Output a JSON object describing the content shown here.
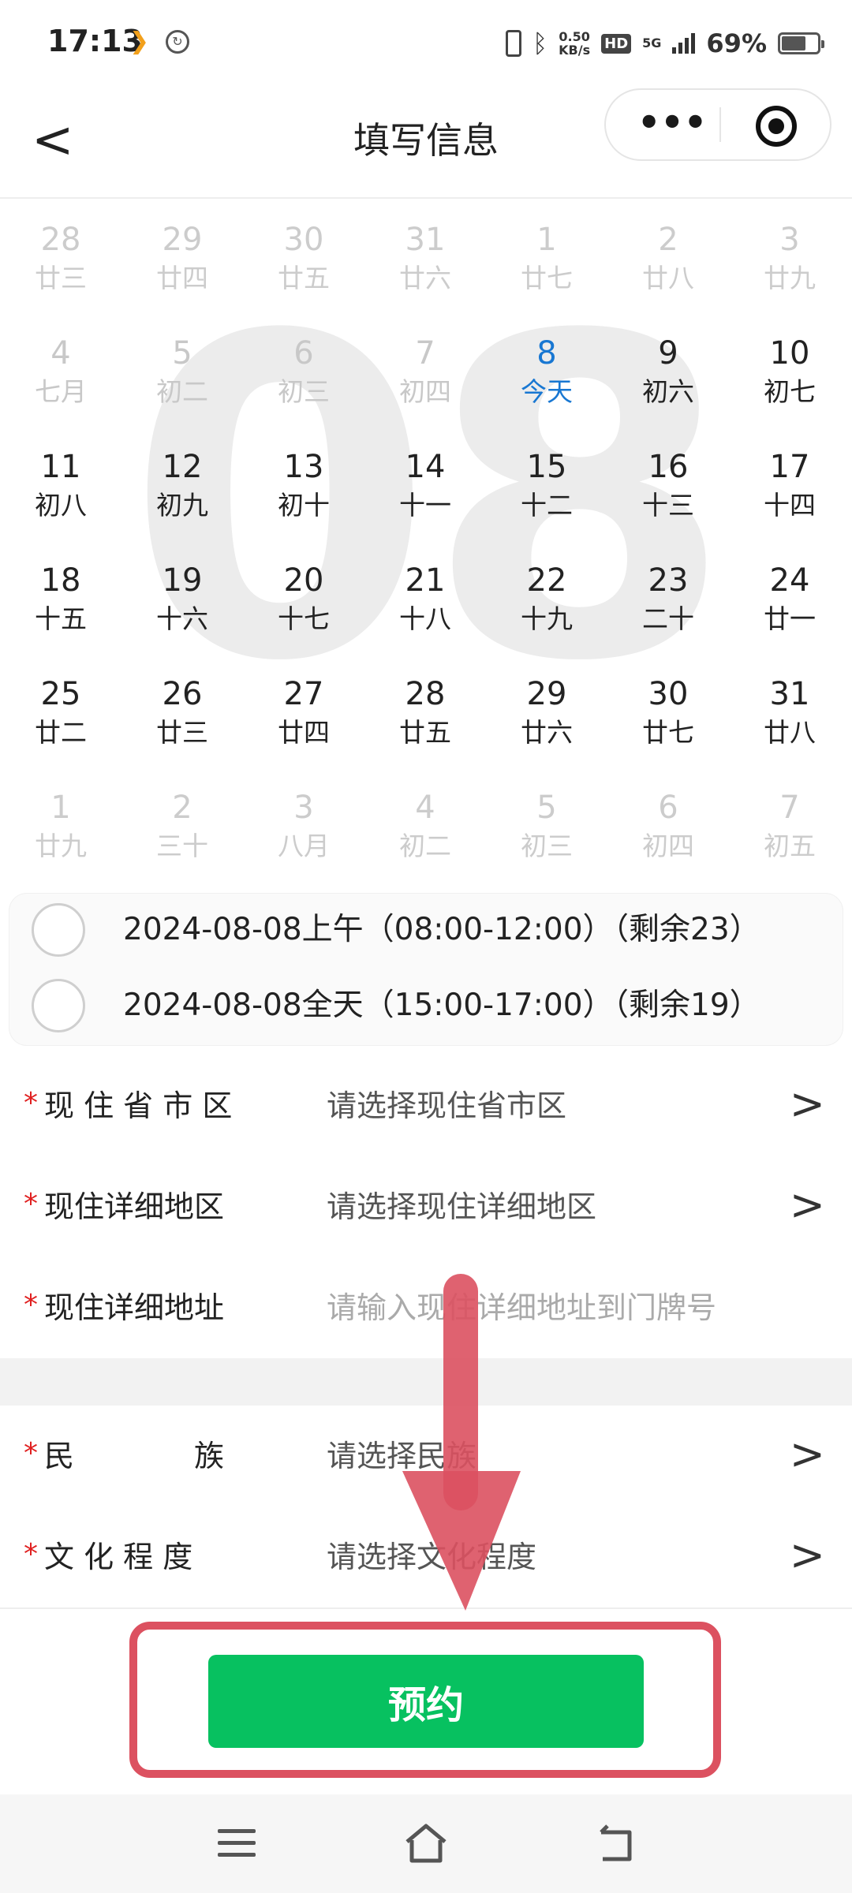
{
  "status_bar": {
    "time": "17:13",
    "speed_top": "0.50",
    "speed_bottom": "KB/s",
    "hd": "HD",
    "network": "5G",
    "battery": "69%"
  },
  "header": {
    "back_glyph": "<",
    "title": "填写信息",
    "more_glyph": "•••"
  },
  "calendar": {
    "month_watermark": "08",
    "rows": [
      [
        {
          "d": "28",
          "l": "廿三",
          "s": "other"
        },
        {
          "d": "29",
          "l": "廿四",
          "s": "other"
        },
        {
          "d": "30",
          "l": "廿五",
          "s": "other"
        },
        {
          "d": "31",
          "l": "廿六",
          "s": "other"
        },
        {
          "d": "1",
          "l": "廿七",
          "s": "other"
        },
        {
          "d": "2",
          "l": "廿八",
          "s": "other"
        },
        {
          "d": "3",
          "l": "廿九",
          "s": "other"
        }
      ],
      [
        {
          "d": "4",
          "l": "七月",
          "s": "past"
        },
        {
          "d": "5",
          "l": "初二",
          "s": "past"
        },
        {
          "d": "6",
          "l": "初三",
          "s": "past"
        },
        {
          "d": "7",
          "l": "初四",
          "s": "past"
        },
        {
          "d": "8",
          "l": "今天",
          "s": "today"
        },
        {
          "d": "9",
          "l": "初六",
          "s": "cur"
        },
        {
          "d": "10",
          "l": "初七",
          "s": "cur"
        }
      ],
      [
        {
          "d": "11",
          "l": "初八",
          "s": "cur"
        },
        {
          "d": "12",
          "l": "初九",
          "s": "cur"
        },
        {
          "d": "13",
          "l": "初十",
          "s": "cur"
        },
        {
          "d": "14",
          "l": "十一",
          "s": "cur"
        },
        {
          "d": "15",
          "l": "十二",
          "s": "cur"
        },
        {
          "d": "16",
          "l": "十三",
          "s": "cur"
        },
        {
          "d": "17",
          "l": "十四",
          "s": "cur"
        }
      ],
      [
        {
          "d": "18",
          "l": "十五",
          "s": "cur"
        },
        {
          "d": "19",
          "l": "十六",
          "s": "cur"
        },
        {
          "d": "20",
          "l": "十七",
          "s": "cur"
        },
        {
          "d": "21",
          "l": "十八",
          "s": "cur"
        },
        {
          "d": "22",
          "l": "十九",
          "s": "cur"
        },
        {
          "d": "23",
          "l": "二十",
          "s": "cur"
        },
        {
          "d": "24",
          "l": "廿一",
          "s": "cur"
        }
      ],
      [
        {
          "d": "25",
          "l": "廿二",
          "s": "cur"
        },
        {
          "d": "26",
          "l": "廿三",
          "s": "cur"
        },
        {
          "d": "27",
          "l": "廿四",
          "s": "cur"
        },
        {
          "d": "28",
          "l": "廿五",
          "s": "cur"
        },
        {
          "d": "29",
          "l": "廿六",
          "s": "cur"
        },
        {
          "d": "30",
          "l": "廿七",
          "s": "cur"
        },
        {
          "d": "31",
          "l": "廿八",
          "s": "cur"
        }
      ],
      [
        {
          "d": "1",
          "l": "廿九",
          "s": "other"
        },
        {
          "d": "2",
          "l": "三十",
          "s": "other"
        },
        {
          "d": "3",
          "l": "八月",
          "s": "other"
        },
        {
          "d": "4",
          "l": "初二",
          "s": "other"
        },
        {
          "d": "5",
          "l": "初三",
          "s": "other"
        },
        {
          "d": "6",
          "l": "初四",
          "s": "other"
        },
        {
          "d": "7",
          "l": "初五",
          "s": "other"
        }
      ]
    ]
  },
  "time_slots": [
    {
      "text": "2024-08-08上午（08:00-12:00）（剩余23）"
    },
    {
      "text": "2024-08-08全天（15:00-17:00）（剩余19）"
    }
  ],
  "form": {
    "required_mark": "*",
    "chevron": ">",
    "province": {
      "label": "现 住 省 市 区",
      "placeholder": "请选择现住省市区"
    },
    "district": {
      "label": "现住详细地区",
      "placeholder": "请选择现住详细地区"
    },
    "address": {
      "label": "现住详细地址",
      "placeholder": "请输入现住详细地址到门牌号"
    },
    "ethnicity": {
      "label": "民　　　　族",
      "placeholder": "请选择民族"
    },
    "education": {
      "label": "文 化 程 度",
      "placeholder": "请选择文化程度"
    }
  },
  "submit": {
    "label": "预约",
    "color": "#07c160"
  },
  "annotation": {
    "color": "#dc5160"
  }
}
